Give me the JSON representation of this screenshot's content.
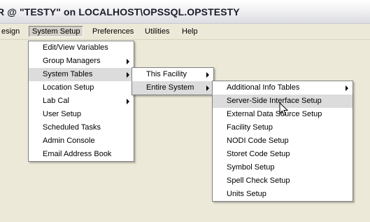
{
  "title": "R @ \"TESTY\" on LOCALHOST\\OPSSQL.OPSTESTY",
  "menubar": [
    "esign",
    "System Setup",
    "Preferences",
    "Utilities",
    "Help"
  ],
  "system_setup_menu": [
    {
      "label": "Edit/View Variables"
    },
    {
      "label": "Group Managers",
      "submenu": true
    },
    {
      "label": "System Tables",
      "submenu": true
    },
    {
      "label": "Location Setup"
    },
    {
      "label": "Lab Cal",
      "submenu": true
    },
    {
      "label": "User Setup"
    },
    {
      "label": "Scheduled Tasks"
    },
    {
      "label": "Admin Console"
    },
    {
      "label": "Email Address Book"
    }
  ],
  "system_tables_menu": [
    {
      "label": "This Facility",
      "submenu": true
    },
    {
      "label": "Entire System",
      "submenu": true
    }
  ],
  "entire_system_menu": [
    {
      "label": "Additional Info Tables",
      "submenu": true
    },
    {
      "label": "Server-Side Interface Setup"
    },
    {
      "label": "External Data Source Setup"
    },
    {
      "label": "Facility Setup"
    },
    {
      "label": "NODI Code Setup"
    },
    {
      "label": "Storet Code Setup"
    },
    {
      "label": "Symbol Setup"
    },
    {
      "label": "Spell Check Setup"
    },
    {
      "label": "Units Setup"
    }
  ],
  "cursor_icon": "arrow-pointer-icon"
}
